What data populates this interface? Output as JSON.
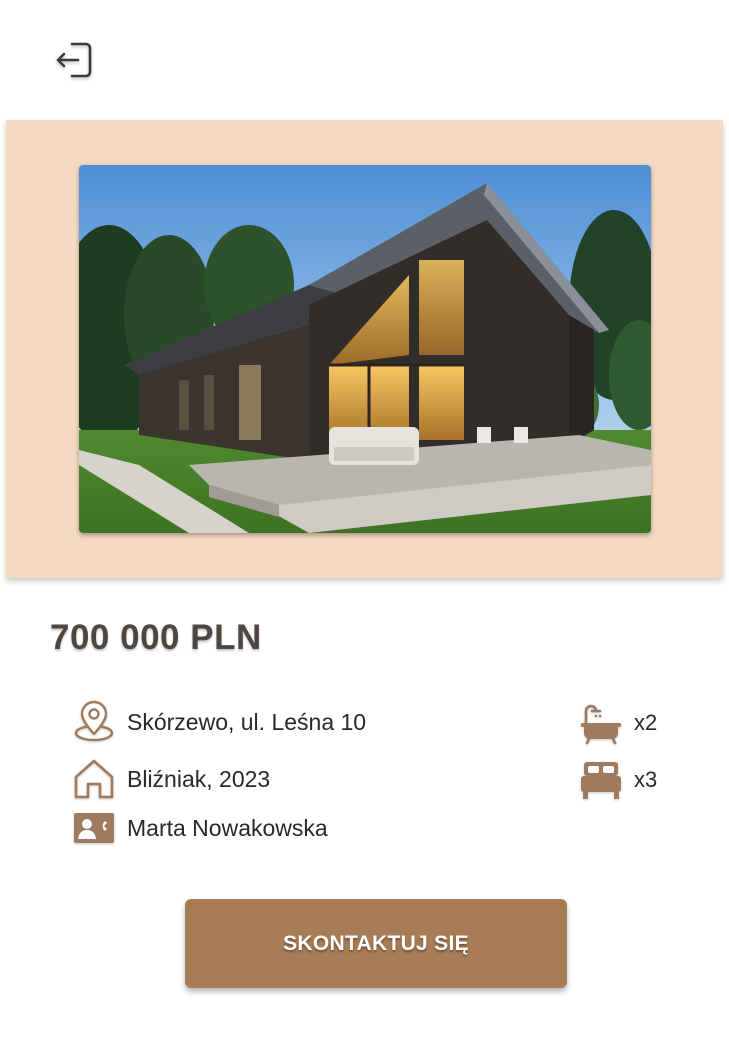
{
  "listing": {
    "price": "700 000 PLN",
    "address": "Skórzewo, ul. Leśna 10",
    "type_year": "Bliźniak, 2023",
    "agent": "Marta Nowakowska",
    "bathrooms": "x2",
    "bedrooms": "x3"
  },
  "actions": {
    "contact_label": "SKONTAKTUJ SIĘ"
  },
  "icons": {
    "back": "logout-icon",
    "location": "location-pin-icon",
    "house": "house-icon",
    "agent": "contact-card-icon",
    "bath": "bathtub-icon",
    "bed": "bed-icon"
  },
  "colors": {
    "hero_background": "#f5dac3",
    "accent": "#a87c57",
    "icon_stroke": "#a07a5c",
    "price_text": "#4e4642"
  }
}
